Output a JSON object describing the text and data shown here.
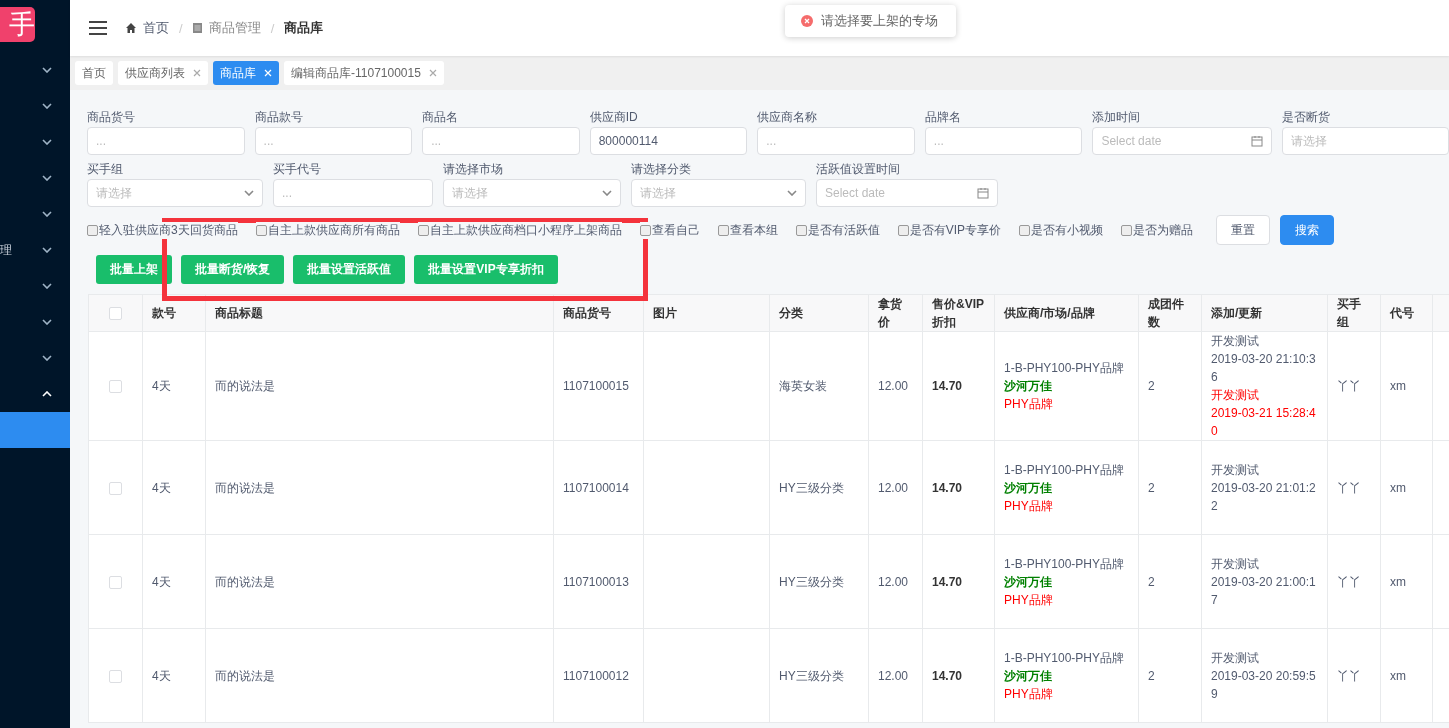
{
  "sidebar": {
    "logo": "手",
    "items": [
      {
        "expanded": false
      },
      {
        "expanded": false
      },
      {
        "expanded": false
      },
      {
        "expanded": false
      },
      {
        "expanded": false
      },
      {
        "label": "理",
        "expanded": false
      },
      {
        "expanded": false
      },
      {
        "expanded": false
      },
      {
        "expanded": false
      },
      {
        "expanded": true,
        "children": [
          {
            "selected": true
          }
        ]
      }
    ]
  },
  "header": {
    "separator": "/",
    "breadcrumb": [
      {
        "label": "首页",
        "current": false
      },
      {
        "label": "商品管理",
        "current": false
      },
      {
        "label": "商品库",
        "current": true
      }
    ]
  },
  "toast": {
    "kind": "error",
    "message": "请选择要上架的专场"
  },
  "tabs": [
    {
      "label": "首页",
      "closable": false,
      "selected": false
    },
    {
      "label": "供应商列表",
      "closable": true,
      "selected": false
    },
    {
      "label": "商品库",
      "closable": true,
      "selected": true
    },
    {
      "label": "编辑商品库-1107100015",
      "closable": true,
      "selected": false
    }
  ],
  "filters": [
    [
      {
        "label": "商品货号",
        "kind": "text",
        "placeholder": "..."
      },
      {
        "label": "商品款号",
        "kind": "text",
        "placeholder": "..."
      },
      {
        "label": "商品名",
        "kind": "text",
        "placeholder": "..."
      },
      {
        "label": "供应商ID",
        "kind": "text",
        "value": "800000114"
      },
      {
        "label": "供应商名称",
        "kind": "text",
        "placeholder": "..."
      },
      {
        "label": "品牌名",
        "kind": "text",
        "placeholder": "..."
      },
      {
        "label": "添加时间",
        "kind": "date",
        "placeholder": "Select date"
      },
      {
        "label": "是否断货",
        "kind": "select-cut",
        "placeholder": "请选择"
      }
    ],
    [
      {
        "label": "买手组",
        "kind": "select",
        "placeholder": "请选择"
      },
      {
        "label": "买手代号",
        "kind": "text",
        "placeholder": "..."
      },
      {
        "label": "请选择市场",
        "kind": "select",
        "placeholder": "请选择"
      },
      {
        "label": "请选择分类",
        "kind": "select",
        "placeholder": "请选择"
      },
      {
        "label": "活跃值设置时间",
        "kind": "date",
        "placeholder": "Select date"
      }
    ]
  ],
  "checkboxes": [
    {
      "label": "轻入驻供应商3天回货商品",
      "checked": false
    },
    {
      "label": "自主上款供应商所有商品",
      "checked": false
    },
    {
      "label": "自主上款供应商档口小程序上架商品",
      "checked": false
    },
    {
      "label": "查看自己",
      "checked": false
    },
    {
      "label": "查看本组",
      "checked": false
    },
    {
      "label": "是否有活跃值",
      "checked": false
    },
    {
      "label": "是否有VIP专享价",
      "checked": false
    },
    {
      "label": "是否有小视频",
      "checked": false
    },
    {
      "label": "是否为赠品",
      "checked": false
    }
  ],
  "filter_buttons": [
    {
      "label": "重置",
      "kind": "default"
    },
    {
      "label": "搜索",
      "kind": "primary"
    }
  ],
  "batch_buttons": [
    "批量上架",
    "批量断货/恢复",
    "批量设置活跃值",
    "批量设置VIP专享折扣"
  ],
  "annotation": {
    "kind": "rectangle"
  },
  "table": {
    "select_all": {
      "checked": false
    },
    "columns": [
      "款号",
      "商品标题",
      "商品货号",
      "图片",
      "分类",
      "拿货价",
      "售价&VIP折扣",
      "供应商/市场/品牌",
      "成团件数",
      "添加/更新",
      "买手组",
      "代号"
    ],
    "rows": [
      {
        "selected": false,
        "style_no": "4天",
        "title": "而的说法是",
        "sku": "1107100015",
        "category": "海英女装",
        "cost": "12.00",
        "price": "14.70",
        "supplier": "1-B-PHY100-PHY品牌",
        "market": "沙河万佳",
        "brand": "PHY品牌",
        "group_size": "2",
        "added_by": "开发测试",
        "added_at": "2019-03-20 21:10:36",
        "updated_by": "开发测试",
        "updated_at": "2019-03-21 15:28:40",
        "buyer_group": "丫丫",
        "code": "xm"
      },
      {
        "selected": false,
        "style_no": "4天",
        "title": "而的说法是",
        "sku": "1107100014",
        "category": "HY三级分类",
        "cost": "12.00",
        "price": "14.70",
        "supplier": "1-B-PHY100-PHY品牌",
        "market": "沙河万佳",
        "brand": "PHY品牌",
        "group_size": "2",
        "added_by": "开发测试",
        "added_at": "2019-03-20 21:01:22",
        "buyer_group": "丫丫",
        "code": "xm"
      },
      {
        "selected": false,
        "style_no": "4天",
        "title": "而的说法是",
        "sku": "1107100013",
        "category": "HY三级分类",
        "cost": "12.00",
        "price": "14.70",
        "supplier": "1-B-PHY100-PHY品牌",
        "market": "沙河万佳",
        "brand": "PHY品牌",
        "group_size": "2",
        "added_by": "开发测试",
        "added_at": "2019-03-20 21:00:17",
        "buyer_group": "丫丫",
        "code": "xm"
      },
      {
        "selected": false,
        "style_no": "4天",
        "title": "而的说法是",
        "sku": "1107100012",
        "category": "HY三级分类",
        "cost": "12.00",
        "price": "14.70",
        "supplier": "1-B-PHY100-PHY品牌",
        "market": "沙河万佳",
        "brand": "PHY品牌",
        "group_size": "2",
        "added_by": "开发测试",
        "added_at": "2019-03-20 20:59:59",
        "buyer_group": "丫丫",
        "code": "xm"
      }
    ]
  }
}
